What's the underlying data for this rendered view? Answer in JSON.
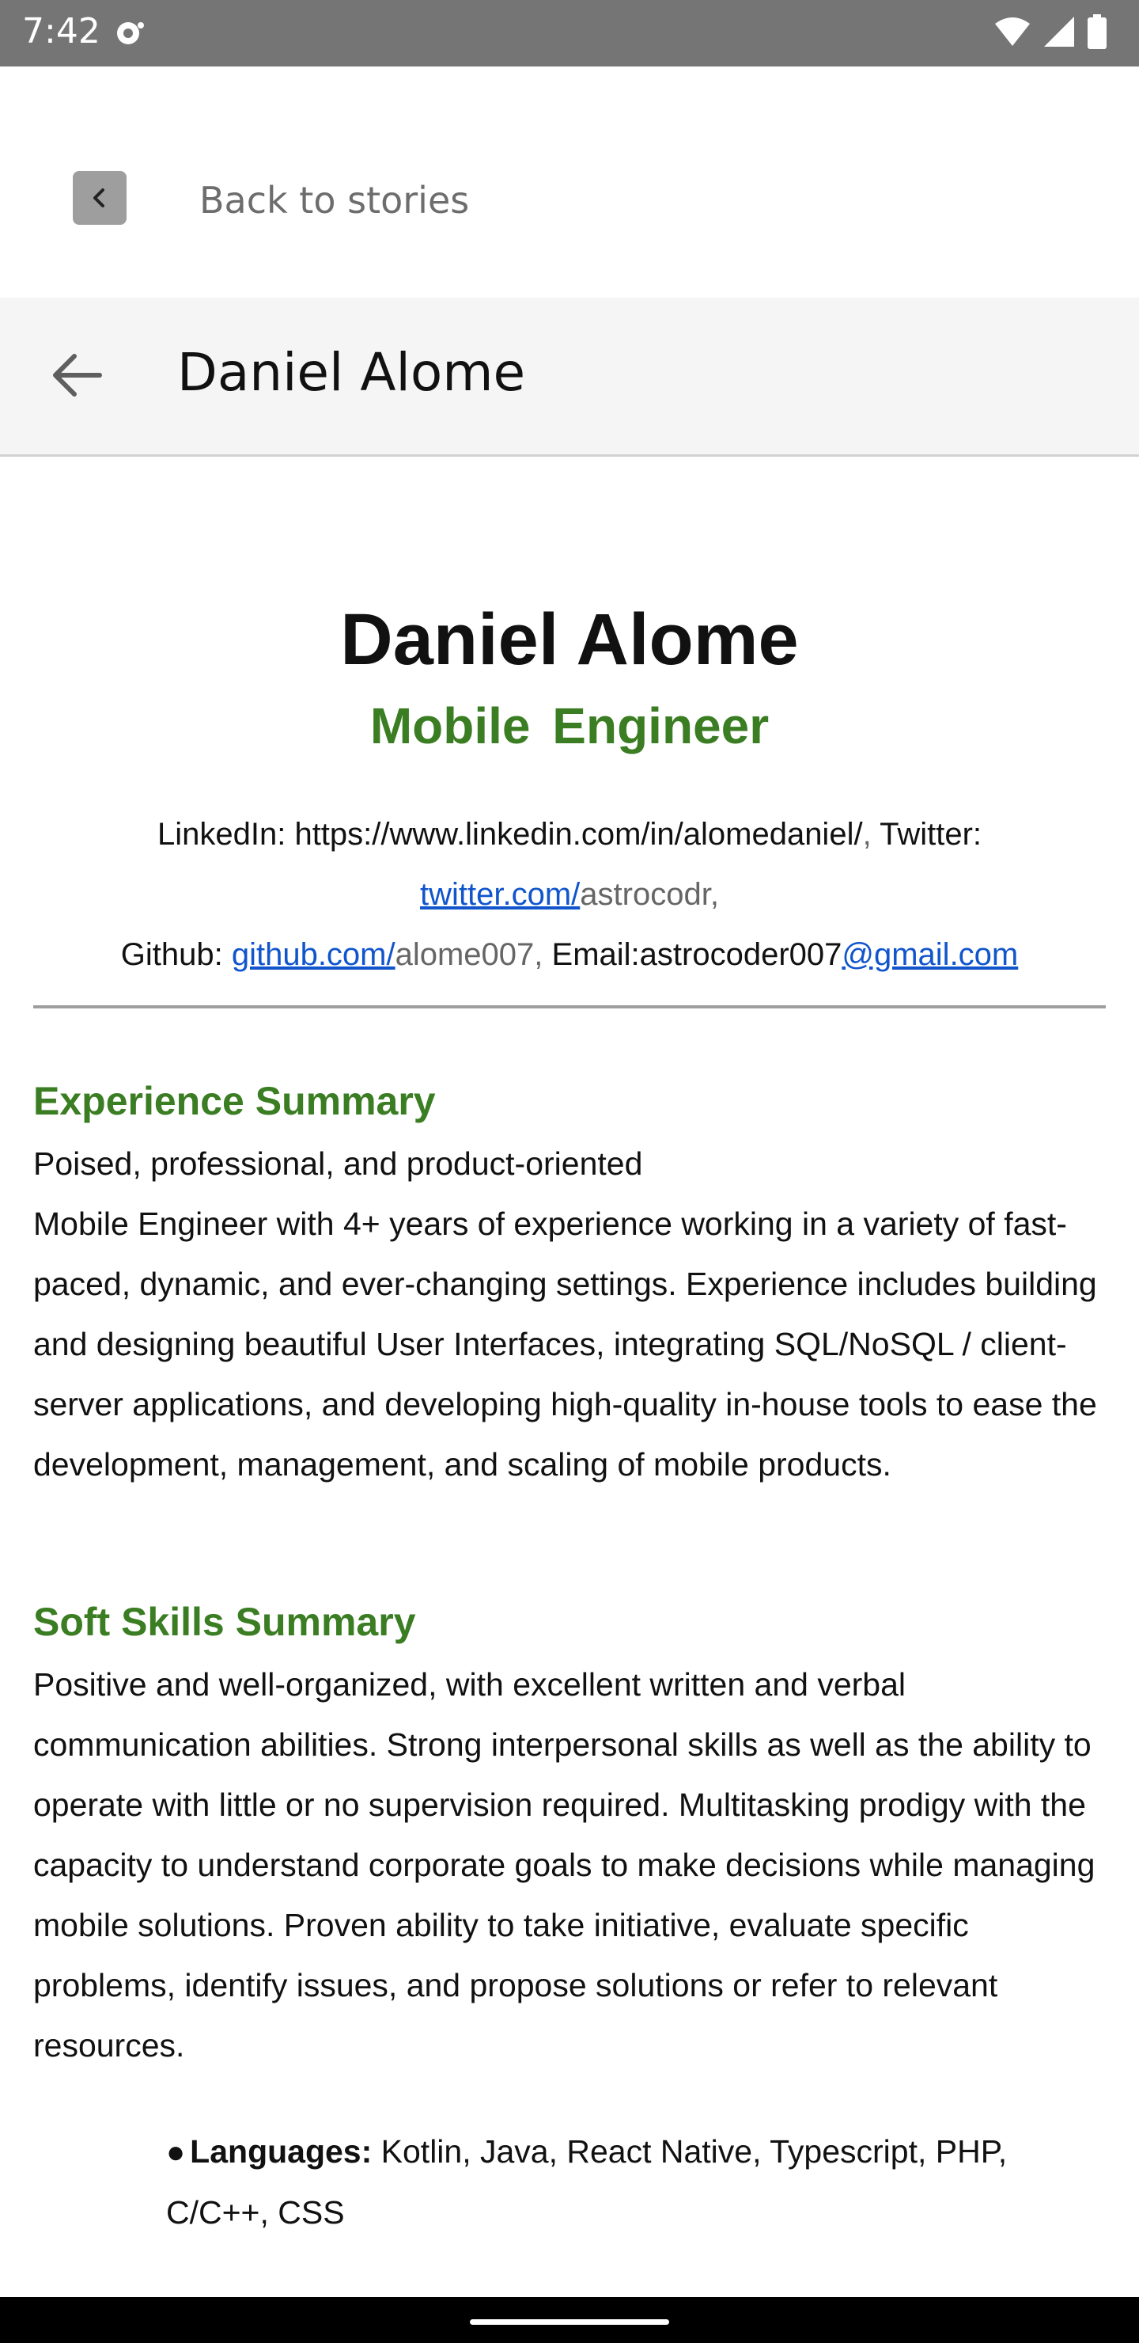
{
  "status_bar": {
    "time": "7:42",
    "icons": [
      "app-notification-icon",
      "wifi-icon",
      "cellular-signal-icon",
      "battery-icon"
    ]
  },
  "stories_bar": {
    "back_label": "Back to stories",
    "back_icon": "chevron-left-icon"
  },
  "app_bar": {
    "back_icon": "arrow-left-icon",
    "title": "Daniel Alome"
  },
  "resume": {
    "name": "Daniel Alome",
    "role": "Mobile  Engineer",
    "contact": {
      "linkedin_text": "LinkedIn: https://www.linkedin.com/in/alomedaniel/",
      "sep1": ",",
      "twitter_label": " Twitter:",
      "twitter_link": "twitter.com/",
      "twitter_handle": "astrocodr,",
      "github_label": "Github: ",
      "github_link": "github.com/",
      "github_handle": "alome007,",
      "email_label": " Email:astrocoder007",
      "email_link": "@gmail.com"
    },
    "experience": {
      "heading": "Experience Summary",
      "line1": "Poised, professional, and product-oriented",
      "body": " Mobile Engineer with 4+ years of experience working in a variety of fast-paced, dynamic, and ever-changing settings. Experience includes building and designing beautiful User Interfaces, integrating SQL/NoSQL / client-server applications, and developing high-quality in-house tools to ease the development, management,  and scaling of mobile products."
    },
    "soft_skills": {
      "heading": "Soft Skills Summary",
      "body": "Positive and well-organized, with excellent written and verbal communication abilities. Strong interpersonal skills as well as the ability to operate with little or no supervision required. Multitasking prodigy with the capacity to understand corporate goals to make decisions while managing mobile solutions. Proven ability to take initiative, evaluate specific problems, identify issues, and propose solutions or refer to relevant resources."
    },
    "skills": {
      "bullet": "●",
      "label": "Languages:",
      "value": " Kotlin,  Java, React Native, Typescript, PHP, C/C++, CSS"
    }
  },
  "colors": {
    "accent_green": "#3a7d22",
    "link_blue": "#1155cc",
    "status_bar_bg": "#757575"
  }
}
